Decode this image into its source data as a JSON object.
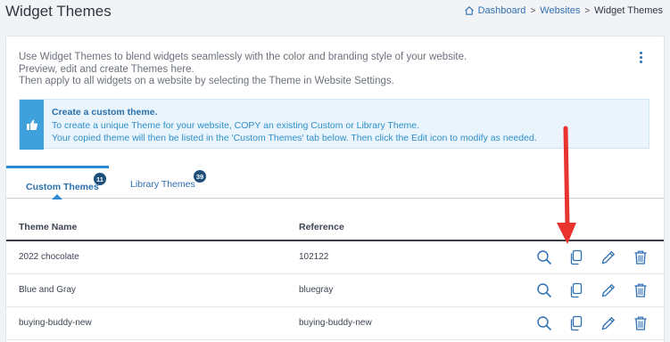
{
  "header": {
    "title": "Widget Themes",
    "breadcrumb": [
      {
        "label": "Dashboard"
      },
      {
        "label": "Websites"
      },
      {
        "label": "Widget Themes"
      }
    ],
    "breadcrumb_separator": ">"
  },
  "intro": {
    "lines": [
      "Use Widget Themes to blend widgets seamlessly with the color and branding style of your website.",
      "Preview, edit and create Themes here.",
      "Then apply to all widgets on a website by selecting the Theme in Website Settings."
    ]
  },
  "callout": {
    "title": "Create a custom theme.",
    "line1": "To create a unique Theme for your website, COPY an existing Custom or Library Theme.",
    "line2": "Your copied theme will then be listed in the 'Custom Themes' tab below. Then click the Edit icon to modify as needed.",
    "icon": "thumbs-up-icon"
  },
  "tabs": [
    {
      "label": "Custom Themes",
      "count": "11",
      "active": true
    },
    {
      "label": "Library Themes",
      "count": "39",
      "active": false
    }
  ],
  "table": {
    "columns": {
      "name": "Theme Name",
      "reference": "Reference"
    },
    "rows": [
      {
        "name": "2022 chocolate",
        "reference": "102122"
      },
      {
        "name": "Blue and Gray",
        "reference": "bluegray"
      },
      {
        "name": "buying-buddy-new",
        "reference": "buying-buddy-new"
      }
    ],
    "row_actions": [
      "search-icon",
      "copy-icon",
      "pencil-icon",
      "trash-icon"
    ]
  },
  "colors": {
    "accent": "#2e6fb3",
    "callout_bg": "#e9f4fc",
    "badge_bg": "#1e4f7c",
    "annotation_arrow": "#e8332f"
  }
}
